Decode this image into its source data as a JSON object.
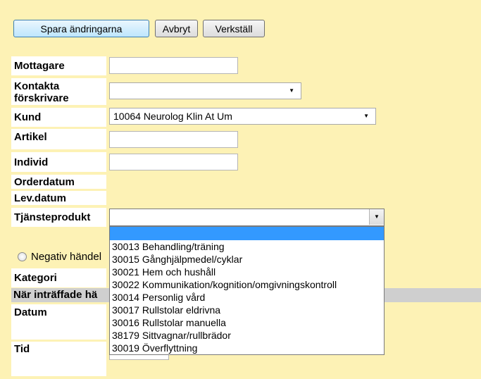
{
  "toolbar": {
    "save_label": "Spara ändringarna",
    "cancel_label": "Avbryt",
    "apply_label": "Verkställ"
  },
  "form": {
    "mottagare": {
      "label": "Mottagare",
      "value": ""
    },
    "kontakta": {
      "label": "Kontakta förskrivare",
      "value": ""
    },
    "kund": {
      "label": "Kund",
      "value": "10064 Neurolog Klin At Um"
    },
    "artikel": {
      "label": "Artikel",
      "value": ""
    },
    "individ": {
      "label": "Individ",
      "value": ""
    },
    "orderdatum": {
      "label": "Orderdatum"
    },
    "levdatum": {
      "label": "Lev.datum"
    },
    "tjansteprodukt": {
      "label": "Tjänsteprodukt",
      "value": ""
    },
    "negativ": {
      "label": "Negativ händel"
    },
    "kategori": {
      "label": "Kategori"
    },
    "when_header": "När inträffade hä",
    "datum": {
      "label": "Datum"
    },
    "tid": {
      "label": "Tid"
    }
  },
  "dropdown_options": [
    "",
    "30013 Behandling/träning",
    "30015 Gånghjälpmedel/cyklar",
    "30021 Hem och hushåll",
    "30022 Kommunikation/kognition/omgivningskontroll",
    "30014 Personlig vård",
    "30017 Rullstolar eldrivna",
    "30016 Rullstolar manuella",
    "38179 Sittvagnar/rullbrädor",
    "30019 Överflyttning"
  ]
}
